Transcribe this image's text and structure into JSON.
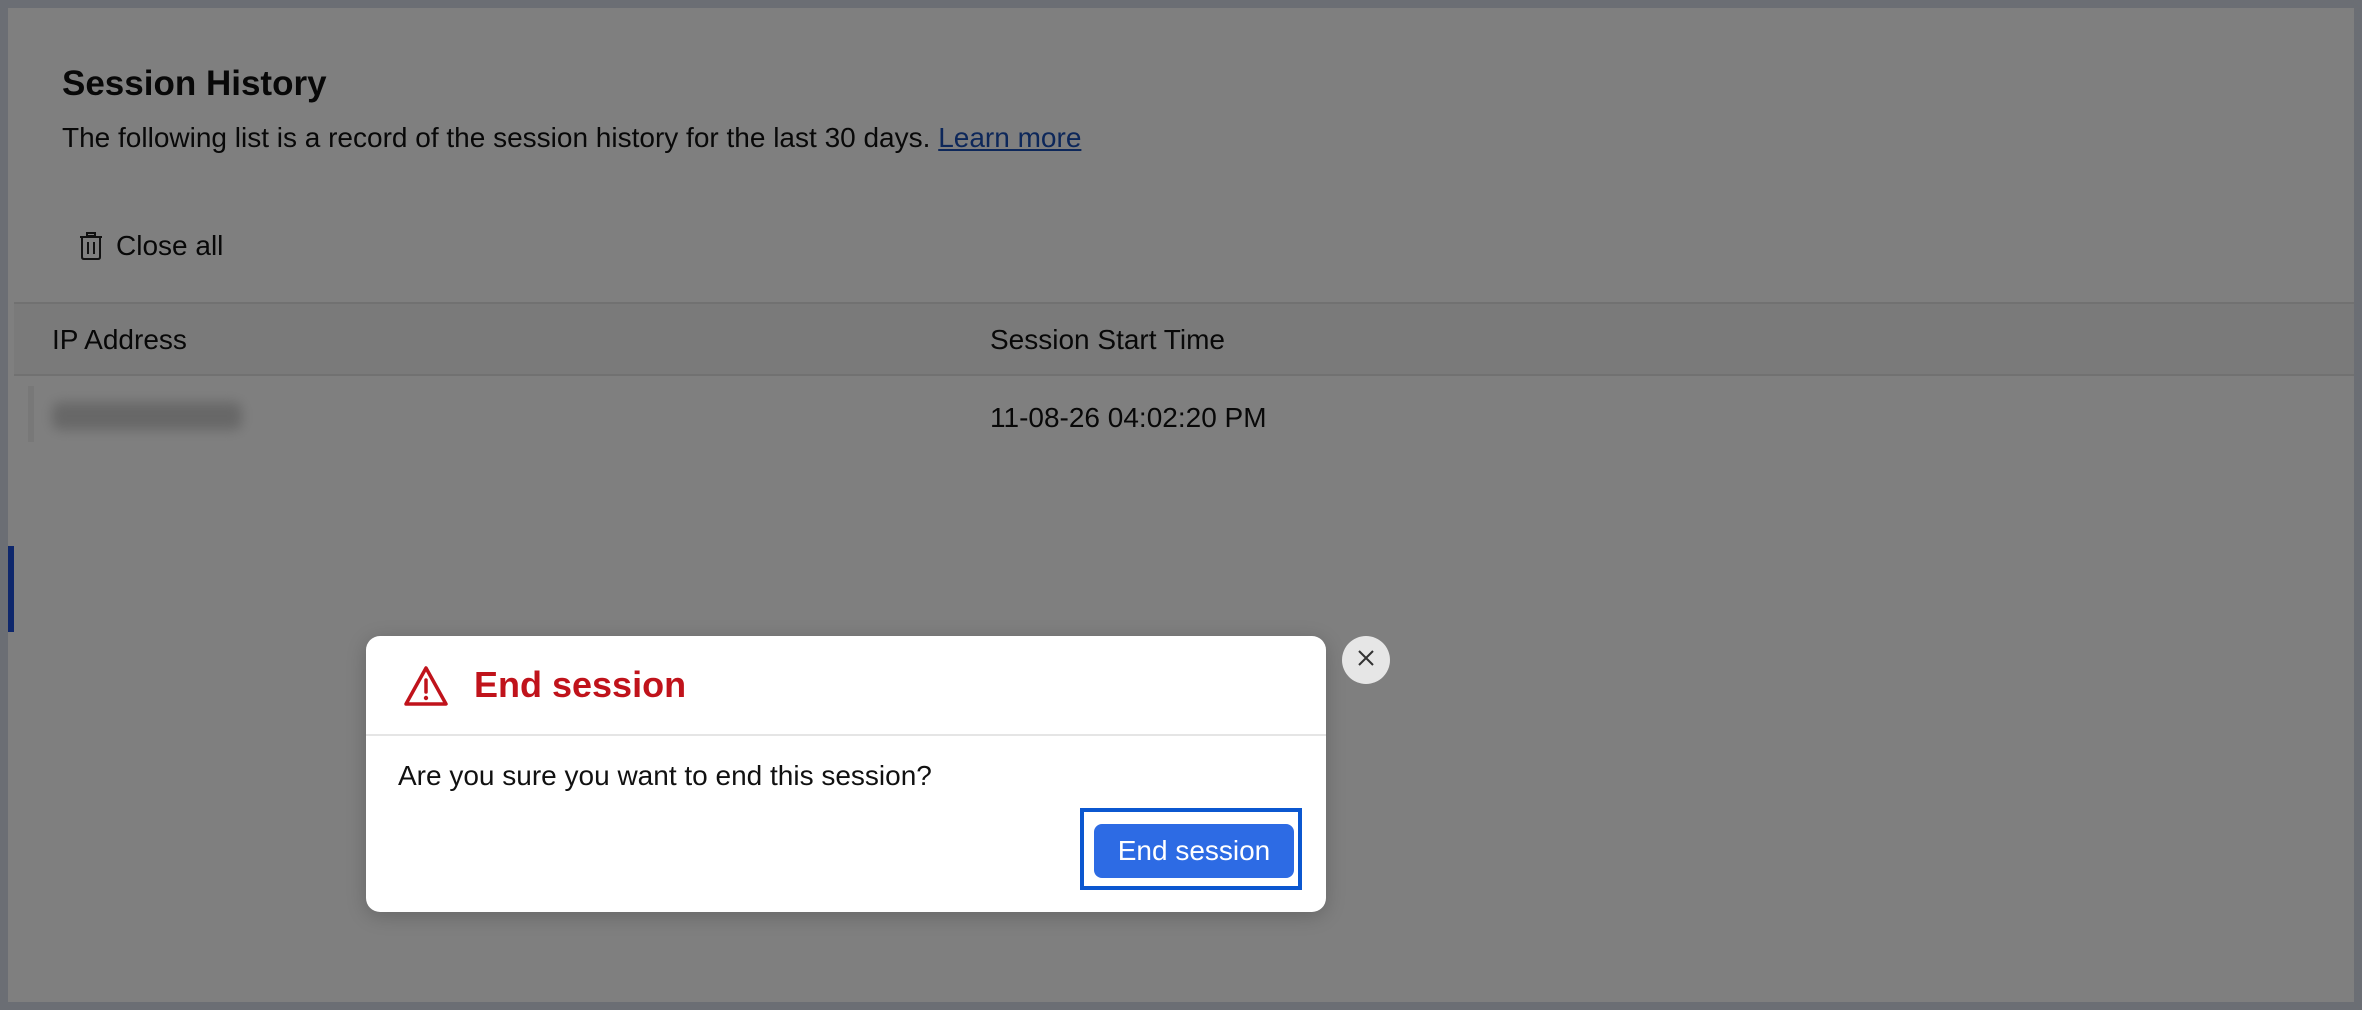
{
  "session_history": {
    "title": "Session History",
    "description": "The following list is a record of the session history for the last 30 days.",
    "learn_more_label": "Learn more",
    "close_all_label": "Close all",
    "close_all_icon": "trash-icon",
    "table": {
      "columns": [
        "IP Address",
        "Session Start Time"
      ],
      "rows": [
        {
          "ip_address": "",
          "session_start_time": "11-08-26 04:02:20 PM"
        }
      ]
    }
  },
  "dialog": {
    "title": "End session",
    "title_icon": "warning-icon",
    "message": "Are you sure you want to end this session?",
    "confirm_label": "End session",
    "close_icon": "close-icon"
  },
  "colors": {
    "dialog_title": "#c0131b",
    "primary_button": "#2d6be4",
    "focus_ring": "#0b57d0",
    "link": "#1a4fb4",
    "overlay": "#000000"
  }
}
